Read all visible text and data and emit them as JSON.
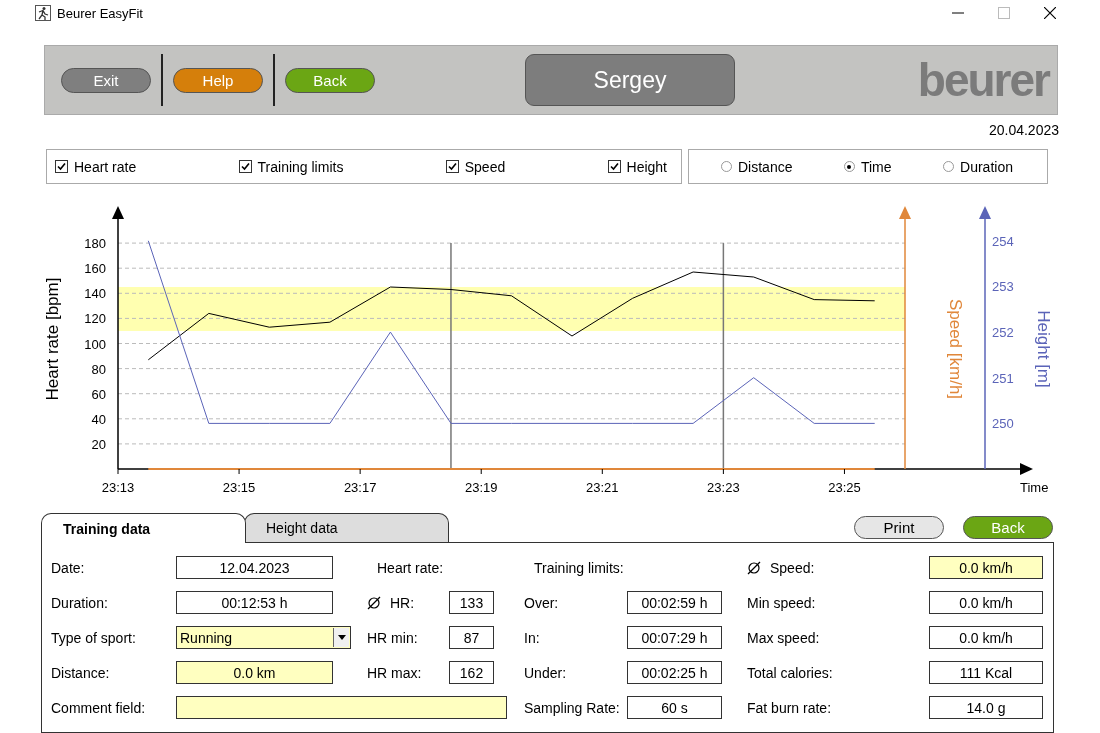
{
  "window": {
    "title": "Beurer EasyFit"
  },
  "header": {
    "buttons": [
      {
        "label": "Exit",
        "color": "#7f7f7f"
      },
      {
        "label": "Help",
        "color": "#d57f0b"
      },
      {
        "label": "Back",
        "color": "#6ba614"
      }
    ],
    "user": "Sergey",
    "logo": "beurer"
  },
  "date": "20.04.2023",
  "display_options": [
    {
      "label": "Heart rate",
      "checked": true
    },
    {
      "label": "Training limits",
      "checked": true
    },
    {
      "label": "Speed",
      "checked": true
    },
    {
      "label": "Height",
      "checked": true
    }
  ],
  "x_axis_modes": [
    {
      "label": "Distance",
      "selected": false
    },
    {
      "label": "Time",
      "selected": true
    },
    {
      "label": "Duration",
      "selected": false
    }
  ],
  "chart": {
    "chart_data": {
      "type": "line",
      "xlabel": "Time",
      "ylabel": "Heart rate [bpm]",
      "y2label": "Height [m]",
      "y3label": "Speed [km/h]",
      "x": [
        1393.5,
        1394.5,
        1395.5,
        1396.5,
        1397.5,
        1398.5,
        1399.5,
        1400.5,
        1401.5,
        1402.5,
        1403.5,
        1404.5,
        1405.5
      ],
      "xlim": [
        1393,
        1406
      ],
      "grid": true,
      "ylim": [
        0,
        200
      ],
      "y2lim": [
        249,
        254.5
      ],
      "y2ticks": [
        250,
        251,
        252,
        253,
        254
      ],
      "xticks": [
        {
          "value": 1393,
          "label": "23:13"
        },
        {
          "value": 1395,
          "label": "23:15"
        },
        {
          "value": 1397,
          "label": "23:17"
        },
        {
          "value": 1399,
          "label": "23:19"
        },
        {
          "value": 1401,
          "label": "23:21"
        },
        {
          "value": 1403,
          "label": "23:23"
        },
        {
          "value": 1405,
          "label": "23:25"
        }
      ],
      "yticks": [
        20,
        40,
        60,
        80,
        100,
        120,
        140,
        160,
        180
      ],
      "series": [
        {
          "color": "#000000",
          "values": [
            87,
            124,
            113,
            117,
            145,
            143,
            138,
            106,
            136,
            157,
            153,
            135,
            134
          ]
        },
        {
          "color": "#e0873a",
          "values": [
            0,
            0,
            0,
            0,
            0,
            0,
            0,
            0,
            0,
            0,
            0,
            0,
            0
          ]
        },
        {
          "color": "#5b64b8",
          "axis": "y2",
          "values": [
            254,
            250,
            250,
            250,
            252,
            250,
            250,
            250,
            250,
            250,
            251,
            250,
            250
          ]
        }
      ],
      "bands": [
        {
          "axis": "y",
          "from": 110,
          "to": 145
        }
      ],
      "ref_lines": [
        {
          "axis": "x",
          "value": 1398.5
        },
        {
          "axis": "x",
          "value": 1403
        }
      ]
    }
  },
  "tabs": [
    {
      "label": "Training data",
      "selected": true
    },
    {
      "label": "Height data",
      "selected": false
    }
  ],
  "actions": [
    {
      "label": "Print",
      "color": "#e6e6e6"
    },
    {
      "label": "Back",
      "color": "#6ba614"
    }
  ],
  "training_data": {
    "rows": [
      [
        {
          "kind": "field",
          "label": "Date:",
          "value": "12.04.2023",
          "highlighted": false
        },
        {
          "kind": "heading",
          "label": "Heart rate:"
        },
        {
          "kind": "heading",
          "label": "Training limits:"
        },
        {
          "kind": "field",
          "label": "Speed:",
          "value": "0.0 km/h",
          "highlighted": true,
          "average": true
        }
      ],
      [
        {
          "kind": "field",
          "label": "Duration:",
          "value": "00:12:53 h",
          "highlighted": false
        },
        {
          "kind": "field",
          "label": "HR:",
          "value": "133",
          "highlighted": false,
          "average": true
        },
        {
          "kind": "field",
          "label": "Over:",
          "value": "00:02:59 h",
          "highlighted": false
        },
        {
          "kind": "field",
          "label": "Min speed:",
          "value": "0.0 km/h",
          "highlighted": false
        }
      ],
      [
        {
          "kind": "dropdown",
          "label": "Type of sport:",
          "value": "Running",
          "highlighted": true
        },
        {
          "kind": "field",
          "label": "HR min:",
          "value": "87",
          "highlighted": false
        },
        {
          "kind": "field",
          "label": "In:",
          "value": "00:07:29 h",
          "highlighted": false
        },
        {
          "kind": "field",
          "label": "Max speed:",
          "value": "0.0 km/h",
          "highlighted": false
        }
      ],
      [
        {
          "kind": "field",
          "label": "Distance:",
          "value": "0.0 km",
          "highlighted": true
        },
        {
          "kind": "field",
          "label": "HR max:",
          "value": "162",
          "highlighted": false
        },
        {
          "kind": "field",
          "label": "Under:",
          "value": "00:02:25 h",
          "highlighted": false
        },
        {
          "kind": "field",
          "label": "Total calories:",
          "value": "111 Kcal",
          "highlighted": false
        }
      ],
      [
        {
          "kind": "wide",
          "label": "Comment field:",
          "highlighted": true
        },
        "",
        {
          "kind": "field",
          "label": "Sampling Rate:",
          "value": "60 s",
          "highlighted": false
        },
        {
          "kind": "field",
          "label": "Fat burn rate:",
          "value": "14.0 g",
          "highlighted": false
        }
      ]
    ]
  }
}
